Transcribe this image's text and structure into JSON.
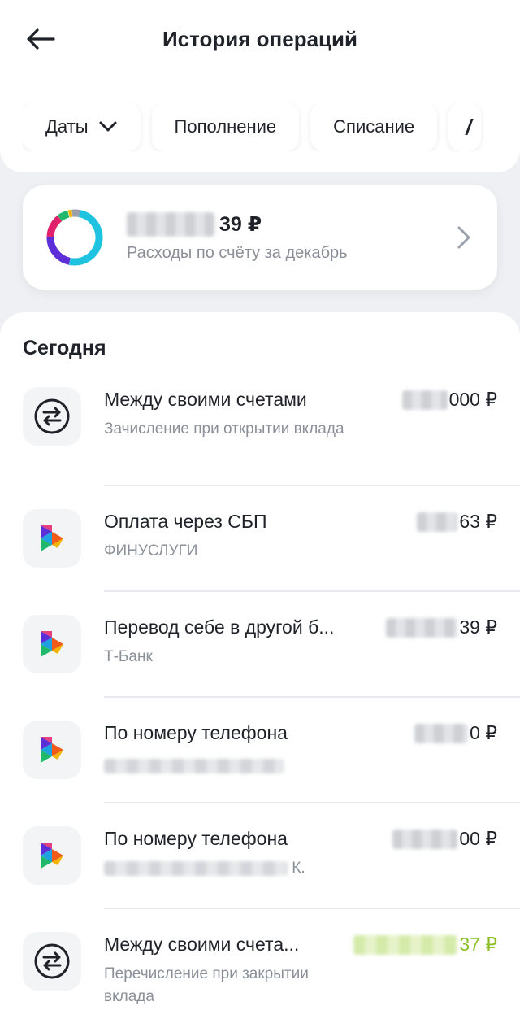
{
  "header": {
    "title": "История операций"
  },
  "filters": {
    "dates_label": "Даты",
    "income_label": "Пополнение",
    "expense_label": "Списание"
  },
  "summary": {
    "amount_visible": "39 ₽",
    "subtitle": "Расходы по счёту за декабрь",
    "donut_colors": [
      "#1fc3e0",
      "#5b2ed8",
      "#e0206a",
      "#20b86a",
      "#9aa1ab"
    ]
  },
  "section": {
    "title": "Сегодня"
  },
  "operations": [
    {
      "title": "Между своими счетами",
      "subtitle": "Зачисление при открытии вклада",
      "amount_visible": "000 ₽",
      "icon": "transfer-arrows-icon",
      "credit": false
    },
    {
      "title": "Оплата через СБП",
      "subtitle": "ФИНУСЛУГИ",
      "amount_visible": "63 ₽",
      "icon": "sbp-logo-icon",
      "credit": false
    },
    {
      "title": "Перевод себе в другой б...",
      "subtitle": "Т-Банк",
      "amount_visible": "39 ₽",
      "icon": "sbp-logo-icon",
      "credit": false
    },
    {
      "title": "По номеру телефона",
      "subtitle": "",
      "amount_visible": "0 ₽",
      "icon": "sbp-logo-icon",
      "credit": false
    },
    {
      "title": "По номеру телефона",
      "subtitle": "К.",
      "amount_visible": "00 ₽",
      "icon": "sbp-logo-icon",
      "credit": false
    },
    {
      "title": "Между своими счета...",
      "subtitle": "Перечисление при закрытии вклада",
      "amount_visible": "37 ₽",
      "icon": "transfer-arrows-icon",
      "credit": true
    }
  ],
  "colors": {
    "credit": "#8dc028",
    "text": "#1f2229",
    "muted": "#8a8f98"
  }
}
